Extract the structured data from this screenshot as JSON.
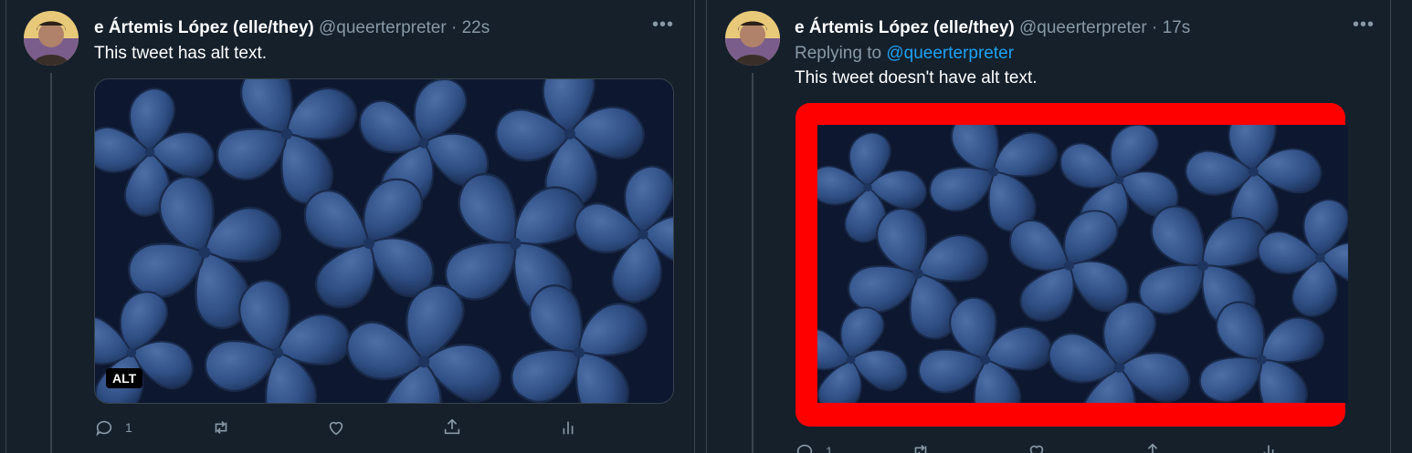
{
  "tweets": [
    {
      "display_name": "e Ártemis López (elle/they)",
      "handle": "@queerterpreter",
      "separator": "·",
      "time": "22s",
      "text": "This tweet has alt text.",
      "alt_badge": "ALT",
      "reply_count": "1"
    },
    {
      "display_name": "e Ártemis López (elle/they)",
      "handle": "@queerterpreter",
      "separator": "·",
      "time": "17s",
      "replying_to_label": "Replying to",
      "replying_to_handle": "@queerterpreter",
      "text": "This tweet doesn't have alt text.",
      "reply_count": "1",
      "highlight_color": "#ff0000"
    }
  ],
  "icons": [
    "more-icon",
    "reply-icon",
    "retweet-icon",
    "like-icon",
    "share-icon",
    "analytics-icon"
  ],
  "colors": {
    "background": "#15202b",
    "border": "#38444d",
    "secondary_text": "#8899a6",
    "link": "#1da1f2"
  }
}
